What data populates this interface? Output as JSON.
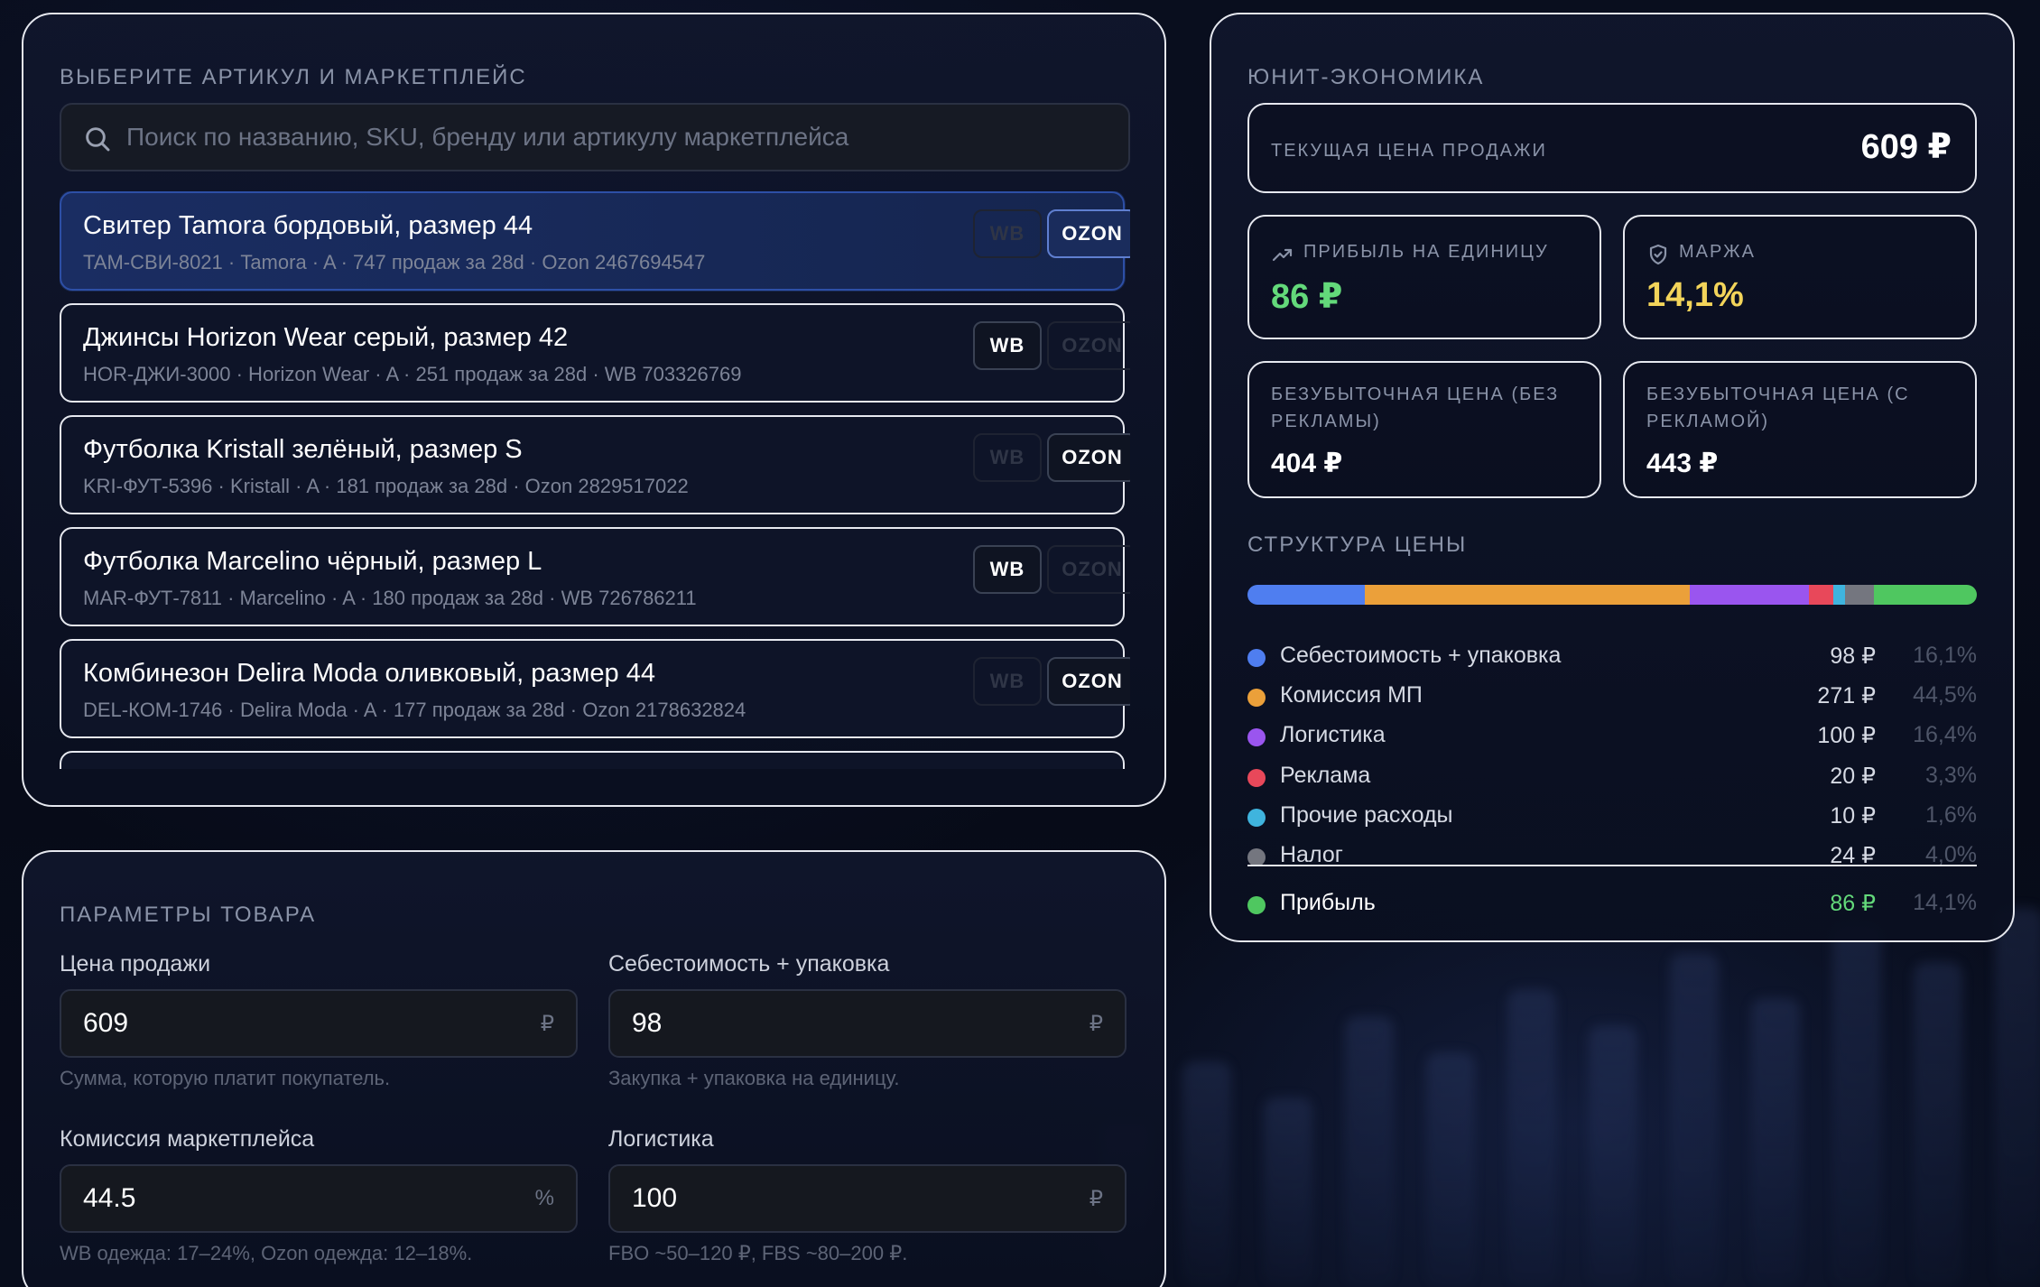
{
  "search_panel": {
    "title": "Выберите артикул и маркетплейс",
    "search_placeholder": "Поиск по названию, SKU, бренду или артикулу маркетплейса",
    "wb_label": "WB",
    "ozon_label": "OZON",
    "products": [
      {
        "name": "Свитер Tamora бордовый, размер 44",
        "meta": "TAM-СВИ-8021 · Tamora · A · 747 продаж за 28d · Ozon 2467694547",
        "wb_active": false,
        "ozon_active": true,
        "selected": true
      },
      {
        "name": "Джинсы Horizon Wear серый, размер 42",
        "meta": "HOR-ДЖИ-3000 · Horizon Wear · A · 251 продаж за 28d · WB 703326769",
        "wb_active": true,
        "ozon_active": false,
        "selected": false
      },
      {
        "name": "Футболка Kristall зелёный, размер S",
        "meta": "KRI-ФУТ-5396 · Kristall · A · 181 продаж за 28d · Ozon 2829517022",
        "wb_active": false,
        "ozon_active": true,
        "selected": false
      },
      {
        "name": "Футболка Marcelino чёрный, размер L",
        "meta": "MAR-ФУТ-7811 · Marcelino · A · 180 продаж за 28d · WB 726786211",
        "wb_active": true,
        "ozon_active": false,
        "selected": false
      },
      {
        "name": "Комбинезон Delira Moda оливковый, размер 44",
        "meta": "DEL-КОМ-1746 · Delira Moda · A · 177 продаж за 28d · Ozon 2178632824",
        "wb_active": false,
        "ozon_active": true,
        "selected": false
      }
    ]
  },
  "params_panel": {
    "title": "Параметры товара",
    "fields": [
      {
        "label": "Цена продажи",
        "value": "609",
        "unit": "₽",
        "hint": "Сумма, которую платит покупатель."
      },
      {
        "label": "Себестоимость + упаковка",
        "value": "98",
        "unit": "₽",
        "hint": "Закупка + упаковка на единицу."
      },
      {
        "label": "Комиссия маркетплейса",
        "value": "44.5",
        "unit": "%",
        "hint": "WB одежда: 17–24%, Ozon одежда: 12–18%."
      },
      {
        "label": "Логистика",
        "value": "100",
        "unit": "₽",
        "hint": "FBO ~50–120 ₽, FBS ~80–200 ₽."
      }
    ]
  },
  "unit_panel": {
    "title": "Юнит-экономика",
    "current_price": {
      "label": "Текущая цена продажи",
      "value": "609 ₽"
    },
    "profit": {
      "label": "Прибыль на единицу",
      "value": "86 ₽",
      "icon": "trending-up-icon",
      "color": "#63d97a"
    },
    "margin": {
      "label": "Маржа",
      "value": "14,1%",
      "icon": "shield-icon",
      "color": "#f3d45a"
    },
    "breakeven_no_ads": {
      "label": "Безубыточная цена (без рекламы)",
      "value": "404 ₽"
    },
    "breakeven_ads": {
      "label": "Безубыточная цена (с рекламой)",
      "value": "443 ₽"
    },
    "structure_title": "Структура цены",
    "structure": [
      {
        "name": "Себестоимость + упаковка",
        "value": "98 ₽",
        "pct": "16,1%",
        "share": 16.1,
        "color": "#4f7ef0"
      },
      {
        "name": "Комиссия МП",
        "value": "271 ₽",
        "pct": "44,5%",
        "share": 44.5,
        "color": "#eba03a"
      },
      {
        "name": "Логистика",
        "value": "100 ₽",
        "pct": "16,4%",
        "share": 16.4,
        "color": "#9a55ef"
      },
      {
        "name": "Реклама",
        "value": "20 ₽",
        "pct": "3,3%",
        "share": 3.3,
        "color": "#e8485a"
      },
      {
        "name": "Прочие расходы",
        "value": "10 ₽",
        "pct": "1,6%",
        "share": 1.6,
        "color": "#3fb4de"
      },
      {
        "name": "Налог",
        "value": "24 ₽",
        "pct": "4,0%",
        "share": 4.0,
        "color": "#74767f"
      }
    ],
    "total": {
      "name": "Прибыль",
      "value": "86 ₽",
      "pct": "14,1%",
      "share": 14.1,
      "color": "#4fc760"
    }
  }
}
